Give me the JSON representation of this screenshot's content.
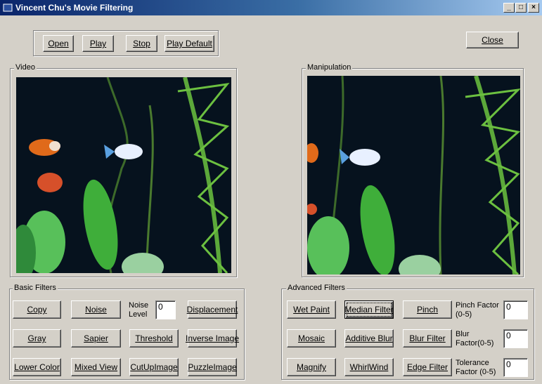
{
  "window": {
    "title": "Vincent Chu's Movie Filtering"
  },
  "toolbar": {
    "open": "Open",
    "play": "Play",
    "stop": "Stop",
    "play_default": "Play Default",
    "close": "Close"
  },
  "groups": {
    "video": "Video",
    "manipulation": "Manipulation",
    "basic": "Basic Filters",
    "advanced": "Advanced Filters"
  },
  "basic": {
    "copy": "Copy",
    "noise": "Noise",
    "displacement": "Displacement",
    "gray": "Gray",
    "sapier": "Sapier",
    "threshold": "Threshold",
    "inverse_image": "Inverse Image",
    "lower_color": "Lower Color",
    "mixed_view": "Mixed View",
    "cutup_image": "CutUpImage",
    "puzzle_image": "PuzzleImage",
    "noise_level_label": "Noise\nLevel",
    "noise_level_value": "0"
  },
  "advanced": {
    "wet_paint": "Wet Paint",
    "median_filter": "Median Filter",
    "pinch": "Pinch",
    "mosaic": "Mosaic",
    "additive_blur": "Additive Blur",
    "blur_filter": "Blur Filter",
    "magnify": "Magnify",
    "whirlwind": "WhirlWind",
    "edge_filter": "Edge Filter",
    "pinch_factor_label": "Pinch Factor\n(0-5)",
    "pinch_factor_value": "0",
    "blur_factor_label": "Blur\nFactor(0-5)",
    "blur_factor_value": "0",
    "tolerance_factor_label": "Tolerance\nFactor (0-5)",
    "tolerance_factor_value": "0"
  },
  "colors": {
    "titlebar_start": "#0a246a",
    "titlebar_end": "#a6caf0",
    "face": "#d4d0c8"
  }
}
